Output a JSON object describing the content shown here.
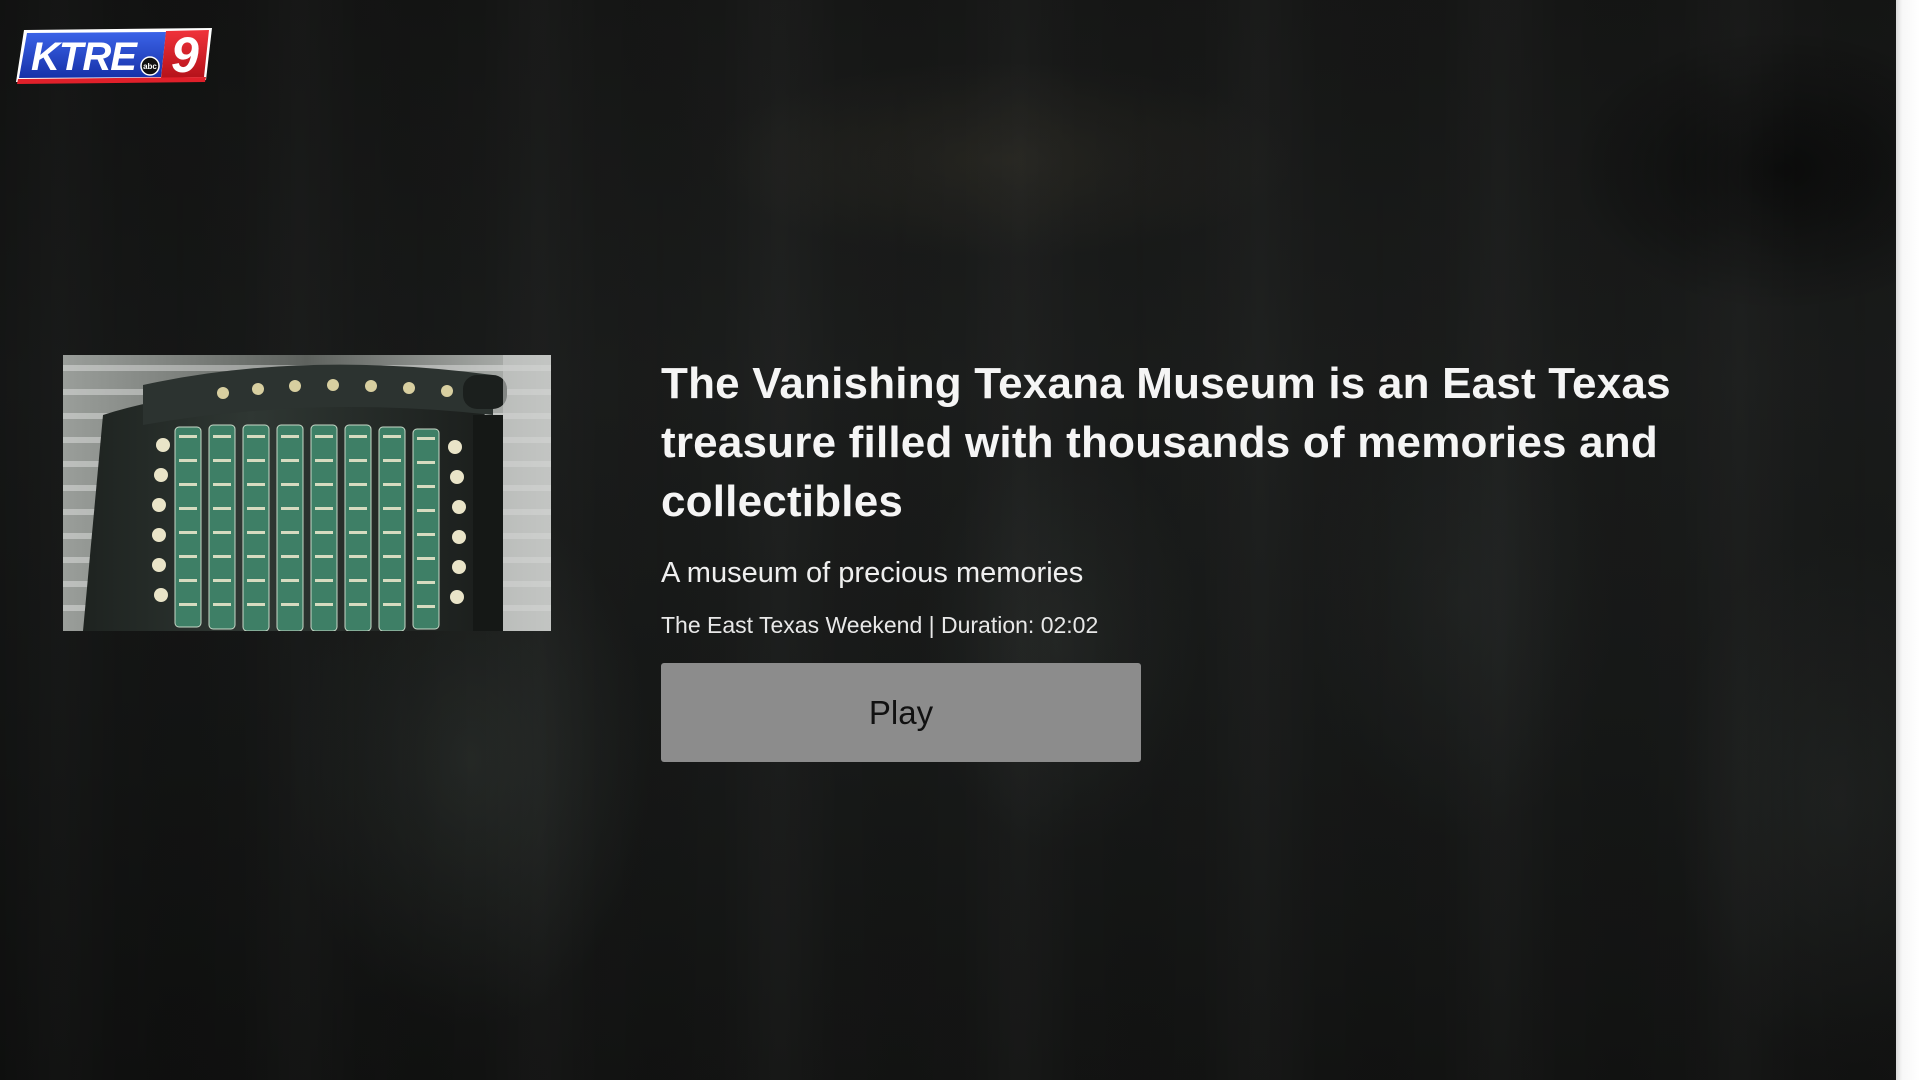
{
  "logo": {
    "station_text": "KTRE",
    "channel_number": "9",
    "network_badge": "abc",
    "colors": {
      "blue": "#1e3fc2",
      "red": "#e0202a",
      "white": "#ffffff"
    }
  },
  "video": {
    "thumbnail_icon": "adding-machine-thumbnail",
    "title": "The Vanishing Texana Museum is an East Texas treasure filled with thousands of memories and collectibles",
    "subtitle": "A museum of precious memories",
    "meta": "The East Texas Weekend | Duration: 02:02"
  },
  "actions": {
    "play_label": "Play"
  },
  "colors": {
    "background": "#151616",
    "button_bg": "#8c8c8c",
    "text": "#f5f5f5"
  }
}
